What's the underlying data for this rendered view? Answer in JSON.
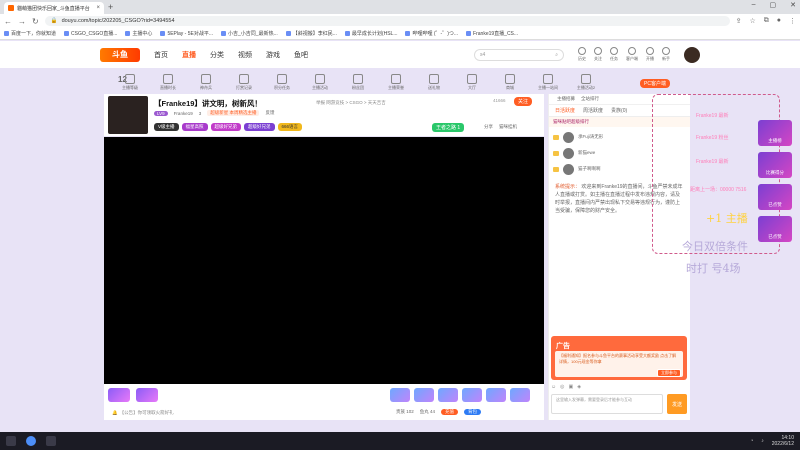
{
  "browser": {
    "tab_title": "貓萌猫团快乐回家_斗鱼直播平台",
    "url": "douyu.com/topic/202205_CSGO?rid=3494554",
    "bookmarks": [
      "百度一下，你就知道",
      "CSGO_CSGO直播...",
      "主播中心",
      "5EPlay - 5E对战平...",
      "小吉_小吉同_最新热...",
      "【斜视搬】李红民...",
      "最早成长计划(HSL...",
      "哔哩哔哩 (゜-゜)つ...",
      "Franke19直播_CS..."
    ]
  },
  "site": {
    "logo": "斗鱼",
    "nav": [
      "首页",
      "直播",
      "分类",
      "视频",
      "游戏",
      "鱼吧"
    ],
    "search_placeholder": "s4",
    "header_icons": [
      "历史",
      "关注",
      "任务",
      "客户端",
      "开播",
      "新手"
    ]
  },
  "toolbar": {
    "level": "12",
    "items": [
      "主播等级",
      "直播时长",
      "神舟兵",
      "打赏记录",
      "积分任务",
      "主播活动",
      "粉丝团",
      "主播荣誉",
      "送礼物",
      "大厅",
      "商城",
      "主播一站间",
      "主播活动2"
    ],
    "pc_btn": "PC客户端"
  },
  "room": {
    "title": "【Franke19】讲文明，树新风！",
    "sub": "举报  网游竞技 > CSGO > 天天吉吉",
    "level_badge": "LV9",
    "streamer": "Franke19",
    "fans": "3",
    "tag_red": "超级新星 本周精选主播",
    "report": "反馈",
    "tags": [
      "V级主播",
      "福星高照",
      "超级好兄弟",
      "超级好兄弟",
      "666语言"
    ],
    "follow_count": "41666",
    "follow_btn": "关注",
    "wzy_btn": "王者之路 1",
    "share": "分享",
    "more": "猫咪挂机"
  },
  "video": {
    "notice": "【公告】你可领取火箭好礼",
    "count1": "贵族 102",
    "count2": "鱼丸 44",
    "btn1": "充值",
    "btn2": "背包"
  },
  "chat": {
    "top": [
      "主播招募",
      "全站排行"
    ],
    "tabs": [
      "日活跃度",
      "周活跃度",
      "贵族(0)"
    ],
    "vip_label": "猫咪贴吧超级排行",
    "ranks": [
      {
        "name": "承Fuji涛无形",
        "badge": "福星 10"
      },
      {
        "name": "新猫ewe",
        "badge": "福星"
      },
      {
        "name": "猫子啊啊啊",
        "badge": "福星"
      }
    ],
    "sys_title": "系统提示：",
    "sys_msg": "欢迎来到Franke19的直播间，斗鱼严禁未成年人直播或打赏。如主播在直播过程中发布违规内容，请及时举报，直播间内严禁出现私下交易等违规行为，谨防上当受骗，保障您的财产安全。",
    "ad_label": "广告",
    "ad_text": "【福利通知】报名参与斗鱼平台的赛事活动享受大额奖励 点击了解详情，100元现金等你拿",
    "ad_btn": "立即参与",
    "input_placeholder": "这里输入发弹幕，需要登录后才能参与互动",
    "send": "发送"
  },
  "overlay": {
    "lines": [
      "Franke19 最新",
      "Franke19 粉丝",
      "Franke19 最新",
      "距离上一场：00000 7516"
    ],
    "big1": "+1 主播",
    "big2": "今日双倍条件",
    "big3": "时打 号4场",
    "side": [
      "主播榜",
      "比赛得分",
      "已点赞",
      "已点赞"
    ]
  },
  "taskbar": {
    "time": "14:10",
    "date": "2022/6/12"
  }
}
